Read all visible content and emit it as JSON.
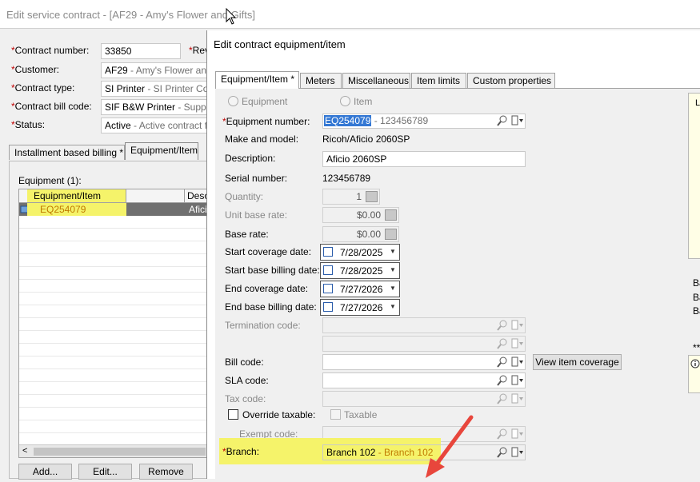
{
  "window": {
    "title": "Edit service contract - [AF29 - Amy's Flower and Gifts]"
  },
  "contract": {
    "number_label": "Contract number:",
    "number_value": "33850",
    "rev_label": "Rev",
    "customer_label": "Customer:",
    "customer_code": "AF29",
    "customer_desc": " - Amy's Flower and Gi",
    "type_label": "Contract type:",
    "type_code": "SI Printer",
    "type_desc": " - SI Printer Contra",
    "billcode_label": "Contract bill code:",
    "billcode_code": "SIF B&W Printer",
    "billcode_desc": " - Supp & Fr",
    "status_label": "Status:",
    "status_code": "Active",
    "status_desc": " - Active contract for"
  },
  "bg_tabs": [
    "Installment based billing *",
    "Equipment/Item"
  ],
  "equipment_list": {
    "label": "Equipment (1):",
    "col1": "Equipment/Item",
    "col2": "Descr",
    "row_id": "EQ254079",
    "row_desc": "Afici",
    "scroll_left": "<"
  },
  "bg_buttons": {
    "add": "Add...",
    "edit": "Edit...",
    "remove": "Remove"
  },
  "dialog": {
    "title": "Edit contract equipment/item",
    "tabs": [
      "Equipment/Item *",
      "Meters",
      "Miscellaneous",
      "Item limits",
      "Custom properties"
    ],
    "radio_equipment": "Equipment",
    "radio_item": "Item",
    "equip_num_label": "Equipment number:",
    "equip_num_value": "EQ254079",
    "equip_num_desc": " - 123456789",
    "make_label": "Make and model:",
    "make_value": "Ricoh/Aficio 2060SP",
    "desc_label": "Description:",
    "desc_value": "Aficio 2060SP",
    "serial_label": "Serial number:",
    "serial_value": "123456789",
    "qty_label": "Quantity:",
    "qty_value": "1",
    "unit_rate_label": "Unit base rate:",
    "unit_rate_value": "$0.00",
    "base_rate_label": "Base rate:",
    "base_rate_value": "$0.00",
    "start_cov_label": "Start coverage date:",
    "start_cov_value": "7/28/2025",
    "start_bill_label": "Start base billing date:",
    "start_bill_value": "7/28/2025",
    "end_cov_label": "End coverage date:",
    "end_cov_value": "7/27/2026",
    "end_bill_label": "End base billing date:",
    "end_bill_value": "7/27/2026",
    "term_label": "Termination code:",
    "bill_code_label": "Bill code:",
    "view_coverage_btn": "View item coverage",
    "sla_label": "SLA code:",
    "tax_label": "Tax code:",
    "override_label": "Override taxable:",
    "taxable_label": "Taxable",
    "exempt_label": "Exempt code:",
    "branch_label": "Branch:",
    "branch_code": "Branch 102",
    "branch_desc": " - Branch 102"
  },
  "right_panel": {
    "l": "L",
    "ba1": "Ba",
    "ba2": "Ba",
    "ba3": "Ba",
    "stars": "**"
  },
  "colors": {
    "highlight": "#f5f36a",
    "arrow": "#e8463c",
    "required": "#c00000",
    "selection": "#3478d4"
  }
}
